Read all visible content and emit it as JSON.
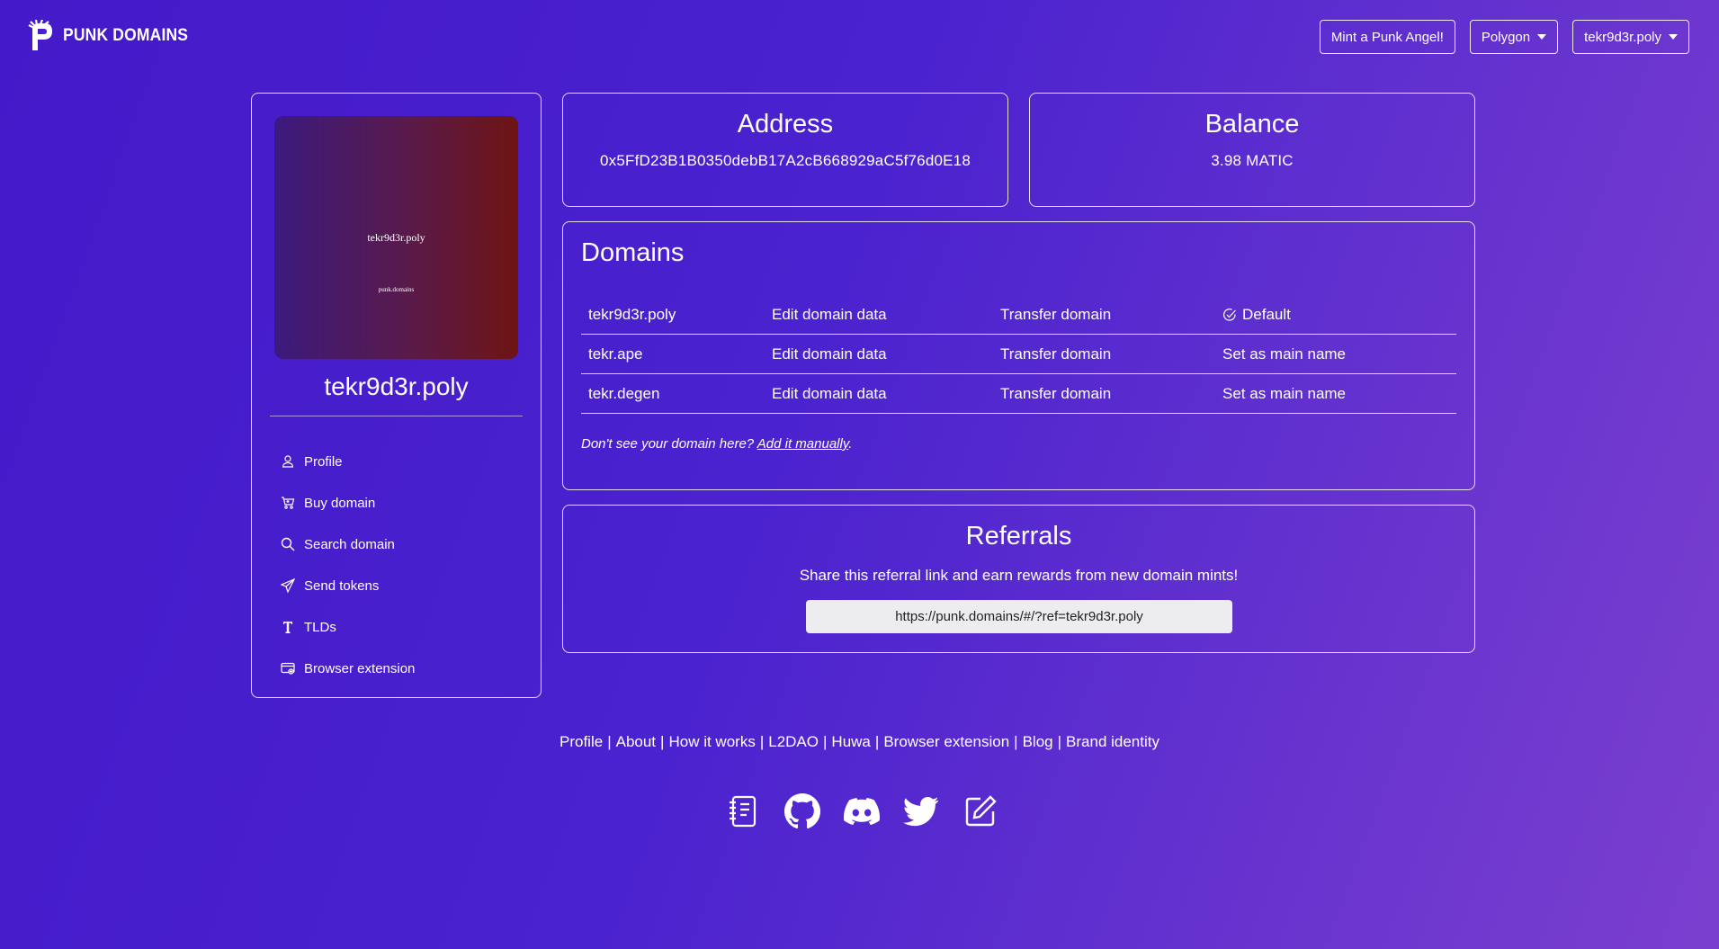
{
  "header": {
    "brand": "PUNK DOMAINS",
    "mint_button": "Mint a Punk Angel!",
    "network_button": "Polygon",
    "account_button": "tekr9d3r.poly"
  },
  "sidebar": {
    "avatar_name": "tekr9d3r.poly",
    "avatar_domain": "punk.domains",
    "domain_name": "tekr9d3r.poly",
    "items": [
      {
        "label": "Profile",
        "icon": "person-icon"
      },
      {
        "label": "Buy domain",
        "icon": "cart-icon"
      },
      {
        "label": "Search domain",
        "icon": "search-icon"
      },
      {
        "label": "Send tokens",
        "icon": "send-icon"
      },
      {
        "label": "TLDs",
        "icon": "type-icon"
      },
      {
        "label": "Browser extension",
        "icon": "browser-icon"
      }
    ]
  },
  "address": {
    "title": "Address",
    "value": "0x5FfD23B1B0350debB17A2cB668929aC5f76d0E18"
  },
  "balance": {
    "title": "Balance",
    "value": "3.98 MATIC"
  },
  "domains": {
    "title": "Domains",
    "rows": [
      {
        "name": "tekr9d3r.poly",
        "edit": "Edit domain data",
        "transfer": "Transfer domain",
        "status": "Default"
      },
      {
        "name": "tekr.ape",
        "edit": "Edit domain data",
        "transfer": "Transfer domain",
        "status": "Set as main name"
      },
      {
        "name": "tekr.degen",
        "edit": "Edit domain data",
        "transfer": "Transfer domain",
        "status": "Set as main name"
      }
    ],
    "note": "Don't see your domain here?",
    "note_link": "Add it manually",
    "note_end": "."
  },
  "referrals": {
    "title": "Referrals",
    "subtitle": "Share this referral link and earn rewards from new domain mints!",
    "link": "https://punk.domains/#/?ref=tekr9d3r.poly"
  },
  "footer": {
    "links": [
      "Profile",
      "About",
      "How it works",
      "L2DAO",
      "Huwa",
      "Browser extension",
      "Blog",
      "Brand identity"
    ],
    "separator": "|",
    "icons": [
      "docs-icon",
      "github-icon",
      "discord-icon",
      "twitter-icon",
      "edit-icon"
    ]
  }
}
